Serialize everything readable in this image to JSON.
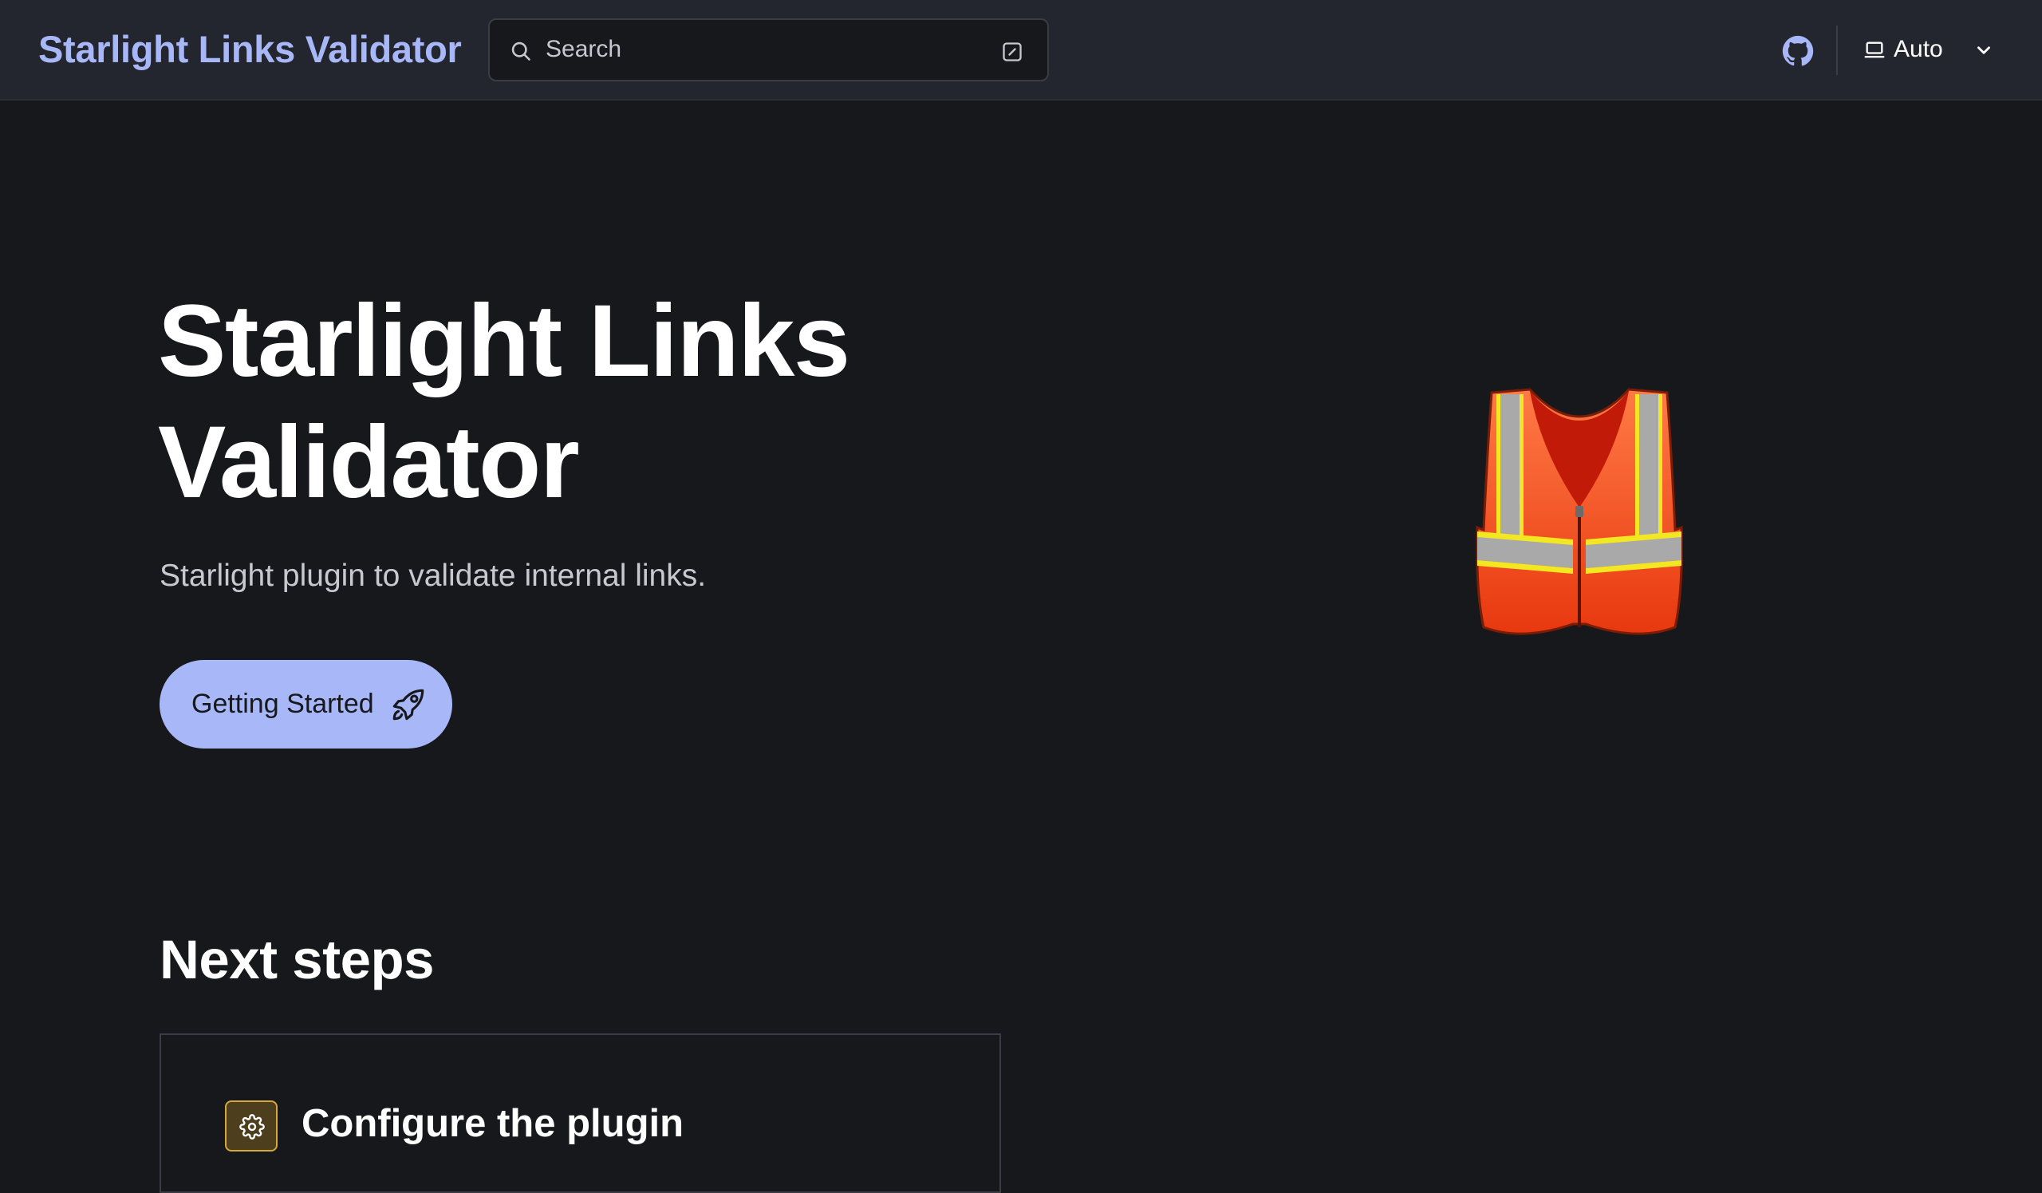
{
  "header": {
    "site_title": "Starlight Links Validator",
    "search": {
      "placeholder": "Search",
      "icon": "search-icon",
      "shortcut_icon": "keyboard-shortcut-icon"
    },
    "github_icon": "github-icon",
    "theme": {
      "icon": "laptop-icon",
      "selected": "Auto",
      "chevron": "chevron-down-icon"
    }
  },
  "hero": {
    "title": "Starlight Links Validator",
    "tagline": "Starlight plugin to validate internal links.",
    "cta": {
      "label": "Getting Started",
      "icon": "rocket-icon"
    },
    "image": "safety-vest-emoji"
  },
  "next_steps": {
    "title": "Next steps",
    "cards": [
      {
        "title": "Configure the plugin",
        "icon": "gear-icon"
      }
    ]
  },
  "colors": {
    "accent": "#a8b7f7",
    "background": "#17181c",
    "header_bg": "#23262f",
    "card_icon_bg": "#4d3f1d",
    "card_icon_border": "#d5a83a"
  }
}
